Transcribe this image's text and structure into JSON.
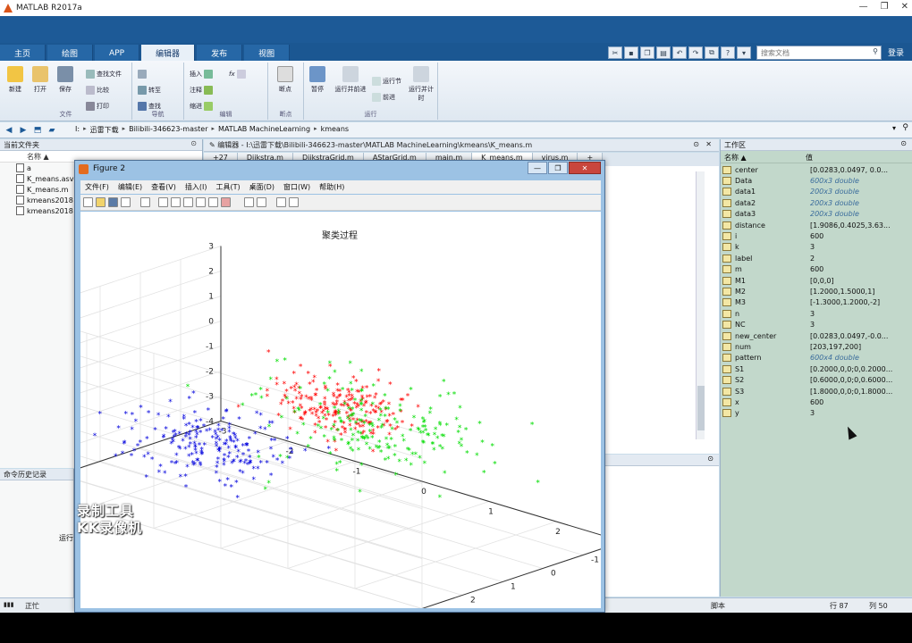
{
  "app": {
    "title": "MATLAB R2017a",
    "window_controls": [
      "—",
      "❐",
      "✕"
    ]
  },
  "ribbon_tabs": [
    "主页",
    "绘图",
    "APP",
    "编辑器",
    "发布",
    "视图"
  ],
  "active_tab_index": 3,
  "search": {
    "placeholder": "搜索文档",
    "login_label": "登录"
  },
  "ribbon": {
    "file": {
      "new": "新建",
      "open": "打开",
      "save": "保存",
      "find_files": "查找文件",
      "compare": "比较",
      "print": "打印",
      "group": "文件"
    },
    "navigate": {
      "goto": "转至",
      "find": "查找",
      "group": "导航"
    },
    "edit": {
      "insert": "插入",
      "comment": "注释",
      "indent": "缩进",
      "fx": "fx",
      "group": "编辑"
    },
    "breakpoints": {
      "label": "断点",
      "group": "断点"
    },
    "run": {
      "run": "运行",
      "run_advance": "运行并前进",
      "run_section": "运行节",
      "advance": "前进",
      "run_time": "运行并计时",
      "group": "运行"
    }
  },
  "address": {
    "crumbs": [
      "I:",
      "迅雷下载",
      "Bilibili-346623-master",
      "MATLAB MachineLearning",
      "kmeans"
    ]
  },
  "current_folder": {
    "title": "当前文件夹",
    "column_name": "名称 ▲",
    "files": [
      "a",
      "K_means.asv",
      "K_means.m",
      "kmeans2018",
      "kmeans2018"
    ]
  },
  "command_history": {
    "title": "命令历史记录",
    "fragment": "运行"
  },
  "editor": {
    "header": "编辑器 - I:\\迅雷下载\\Bilibili-346623-master\\MATLAB MachineLearning\\kmeans\\K_means.m",
    "tabs": [
      "+27",
      "Dijkstra.m",
      "DijkstraGrid.m",
      "AStarGrid.m",
      "main.m",
      "K_means.m",
      "virus.m",
      "+"
    ],
    "active_tab_index": 5
  },
  "workspace": {
    "title": "工作区",
    "col_name": "名称 ▲",
    "col_value": "值",
    "vars": [
      {
        "name": "center",
        "value": "[0.0283,0.0497, 0.0...",
        "italic": false
      },
      {
        "name": "Data",
        "value": "600x3 double",
        "italic": true
      },
      {
        "name": "data1",
        "value": "200x3 double",
        "italic": true
      },
      {
        "name": "data2",
        "value": "200x3 double",
        "italic": true
      },
      {
        "name": "data3",
        "value": "200x3 double",
        "italic": true
      },
      {
        "name": "distance",
        "value": "[1.9086,0.4025,3.63...",
        "italic": false
      },
      {
        "name": "i",
        "value": "600",
        "italic": false
      },
      {
        "name": "k",
        "value": "3",
        "italic": false
      },
      {
        "name": "label",
        "value": "2",
        "italic": false
      },
      {
        "name": "m",
        "value": "600",
        "italic": false
      },
      {
        "name": "M1",
        "value": "[0,0,0]",
        "italic": false
      },
      {
        "name": "M2",
        "value": "[1.2000,1.5000,1]",
        "italic": false
      },
      {
        "name": "M3",
        "value": "[-1.3000,1.2000,-2]",
        "italic": false
      },
      {
        "name": "n",
        "value": "3",
        "italic": false
      },
      {
        "name": "NC",
        "value": "3",
        "italic": false
      },
      {
        "name": "new_center",
        "value": "[0.0283,0.0497,-0.0...",
        "italic": false
      },
      {
        "name": "num",
        "value": "[203,197,200]",
        "italic": false
      },
      {
        "name": "pattern",
        "value": "600x4 double",
        "italic": true
      },
      {
        "name": "S1",
        "value": "[0.2000,0,0;0,0.2000...",
        "italic": false
      },
      {
        "name": "S2",
        "value": "[0.6000,0,0;0,0.6000...",
        "italic": false
      },
      {
        "name": "S3",
        "value": "[1.8000,0,0;0,1.8000...",
        "italic": false
      },
      {
        "name": "x",
        "value": "600",
        "italic": false
      },
      {
        "name": "y",
        "value": "3",
        "italic": false
      }
    ]
  },
  "statusbar": {
    "left": "正忙",
    "script": "脚本",
    "row_label": "行",
    "row": "87",
    "col_label": "列",
    "col": "50"
  },
  "figure": {
    "title": "Figure 2",
    "menu": [
      "文件(F)",
      "编辑(E)",
      "查看(V)",
      "插入(I)",
      "工具(T)",
      "桌面(D)",
      "窗口(W)",
      "帮助(H)"
    ],
    "plot_title": "聚类过程"
  },
  "watermark": {
    "line1": "录制工具",
    "line2": "KK录像机"
  },
  "chart_data": {
    "type": "scatter",
    "title": "聚类过程",
    "marker": "*",
    "xlim": [
      -3,
      3
    ],
    "ylim": [
      -2,
      3
    ],
    "zlim": [
      -4,
      3
    ],
    "x_ticks": [
      -3,
      -2,
      -1,
      0,
      1,
      2,
      3
    ],
    "y_ticks": [
      -2,
      -1,
      0,
      1,
      2,
      3
    ],
    "z_ticks": [
      -4,
      -3,
      -2,
      -1,
      0,
      1,
      2,
      3
    ],
    "grid": true,
    "series": [
      {
        "color": "#ff0000",
        "center": [
          0.05,
          0.05,
          0.05
        ],
        "spread": 0.45,
        "count": 200
      },
      {
        "color": "#00dd00",
        "center": [
          1.2,
          1.5,
          1.0
        ],
        "spread": 0.75,
        "count": 200
      },
      {
        "color": "#0000dd",
        "center": [
          -1.3,
          1.2,
          -2.0
        ],
        "spread": 0.55,
        "count": 200
      }
    ]
  }
}
